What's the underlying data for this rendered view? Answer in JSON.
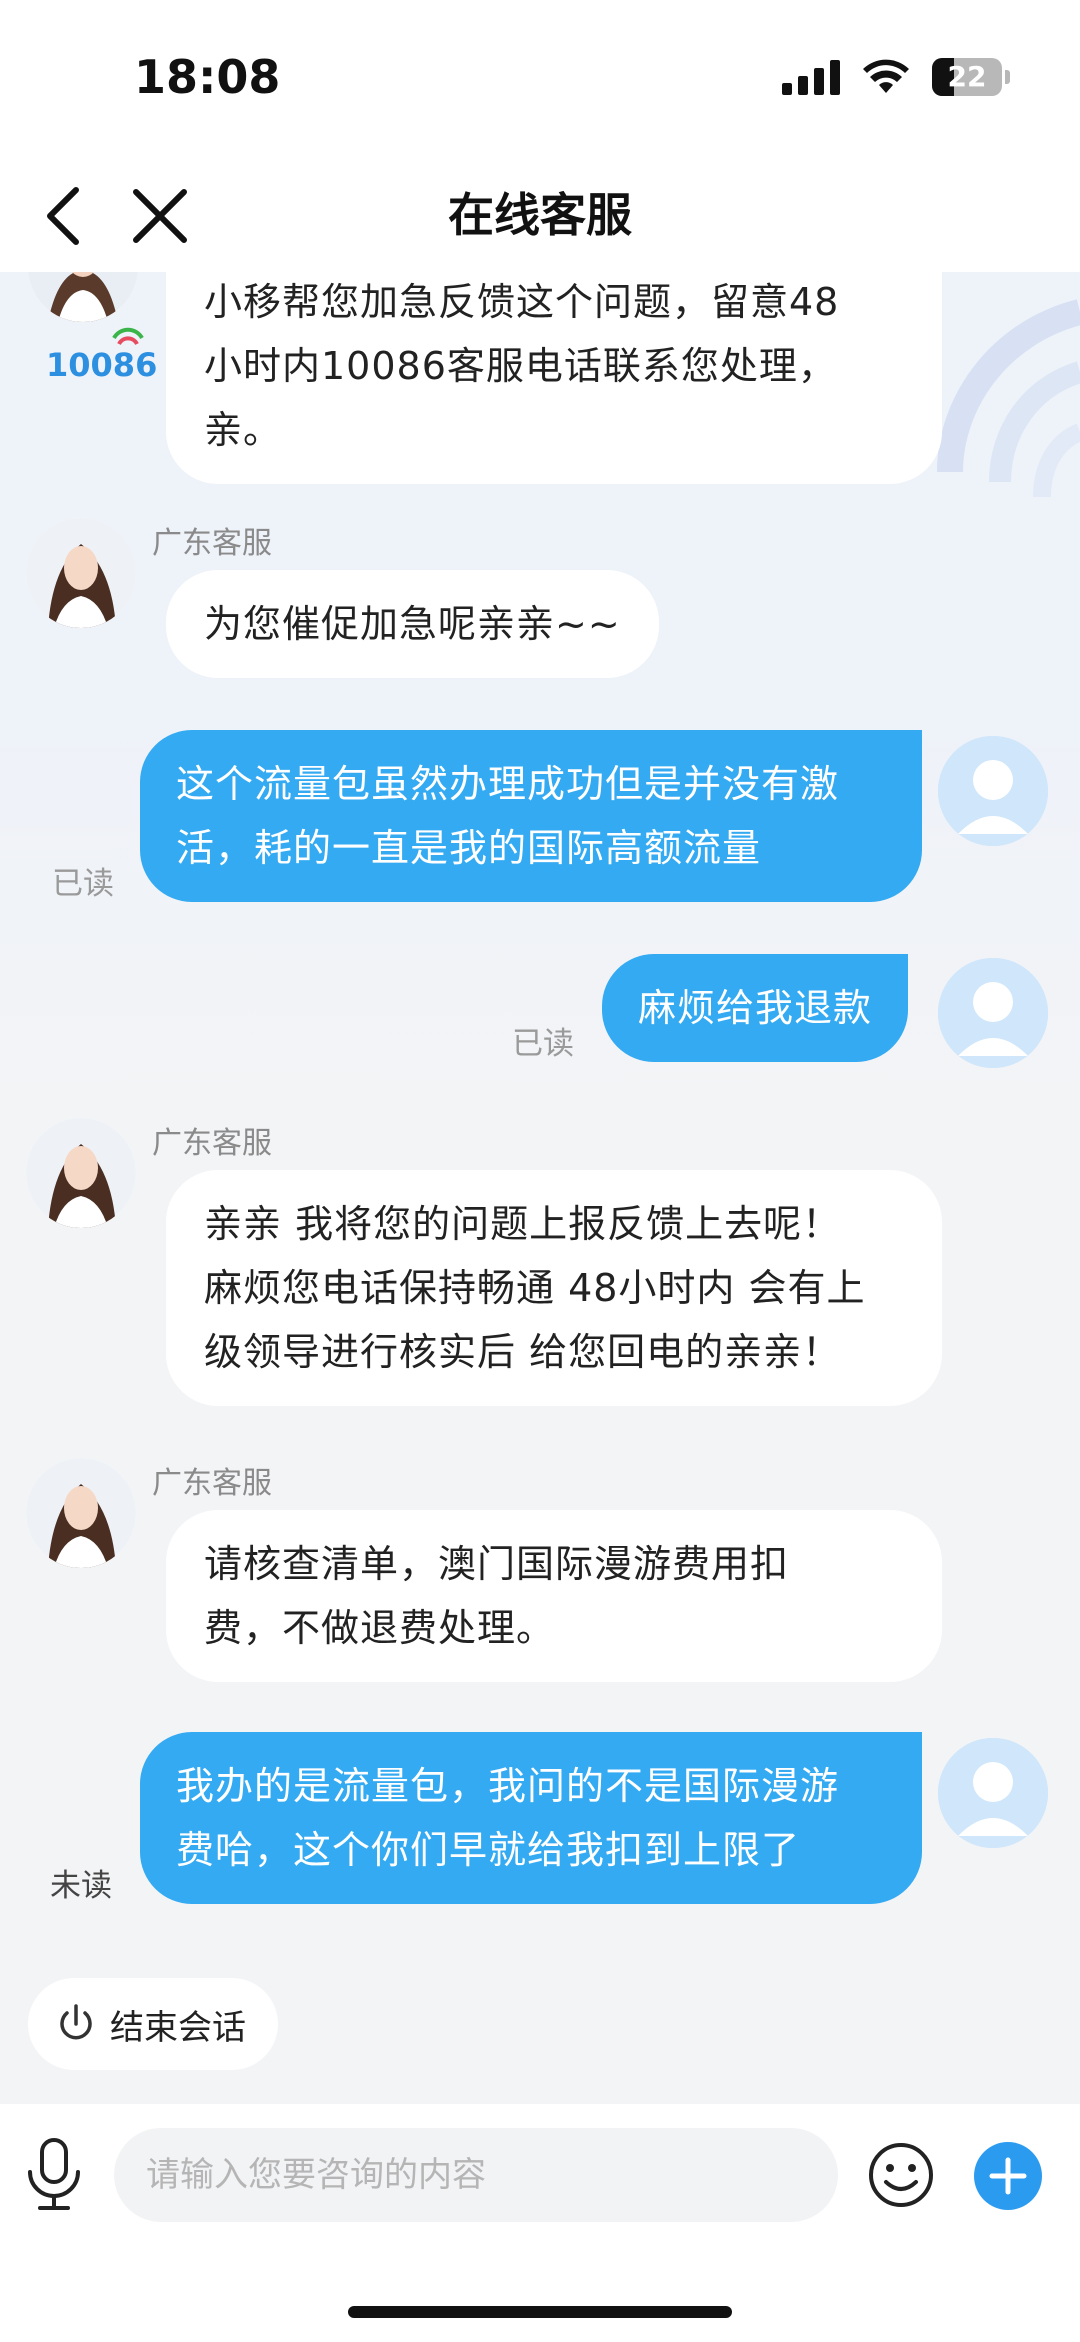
{
  "status_bar": {
    "time": "18:08",
    "battery": "22"
  },
  "nav": {
    "title": "在线客服"
  },
  "messages": [
    {
      "side": "left",
      "text": "小移帮您加急反馈这个问题，留意48\n小时内10086客服电话联系您处理，\n亲。",
      "logo_text": "10086"
    },
    {
      "side": "left",
      "sender": "广东客服",
      "text": "为您催促加急呢亲亲~~"
    },
    {
      "side": "right",
      "text": "这个流量包虽然办理成功但是并没有激\n活，耗的一直是我的国际高额流量",
      "status": "已读"
    },
    {
      "side": "right",
      "text": "麻烦给我退款",
      "status": "已读"
    },
    {
      "side": "left",
      "sender": "广东客服",
      "text": "亲亲 我将您的问题上报反馈上去呢！\n麻烦您电话保持畅通 48小时内 会有上\n级领导进行核实后 给您回电的亲亲！"
    },
    {
      "side": "left",
      "sender": "广东客服",
      "text": "请核查清单，澳门国际漫游费用扣\n费，不做退费处理。"
    },
    {
      "side": "right",
      "text": "我办的是流量包，我问的不是国际漫游\n费哈，这个你们早就给我扣到上限了",
      "status": "未读"
    }
  ],
  "end_session": {
    "label": "结束会话",
    "icon": "power-icon"
  },
  "input_bar": {
    "placeholder": "请输入您要咨询的内容",
    "value": ""
  },
  "colors": {
    "accent": "#33aaf2",
    "plus_button": "#2b9bf0",
    "bubble_left": "#ffffff"
  }
}
